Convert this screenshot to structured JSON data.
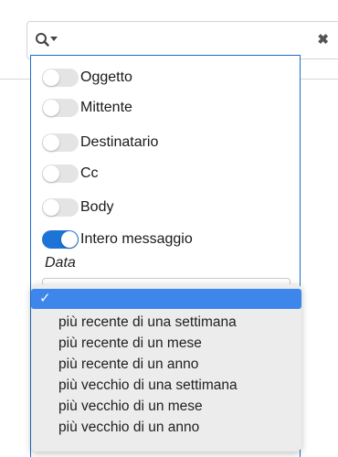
{
  "search": {
    "clear_label": "✖"
  },
  "filters": [
    {
      "label": "Oggetto",
      "on": false
    },
    {
      "label": "Mittente",
      "on": false
    },
    {
      "label": "Destinatario",
      "on": false
    },
    {
      "label": "Cc",
      "on": false
    },
    {
      "label": "Body",
      "on": false
    },
    {
      "label": "Intero messaggio",
      "on": true
    }
  ],
  "date": {
    "label": "Data",
    "check_mark": "✓",
    "options": [
      "",
      "più recente di una settimana",
      "più recente di un mese",
      "più recente di un anno",
      "più vecchio di una settimana",
      "più vecchio di un mese",
      "più vecchio di un anno"
    ],
    "selected_index": 0
  },
  "colors": {
    "accent": "#1d73d6",
    "selected_option": "#3d86ec",
    "dropdown_bg": "#ececec"
  }
}
